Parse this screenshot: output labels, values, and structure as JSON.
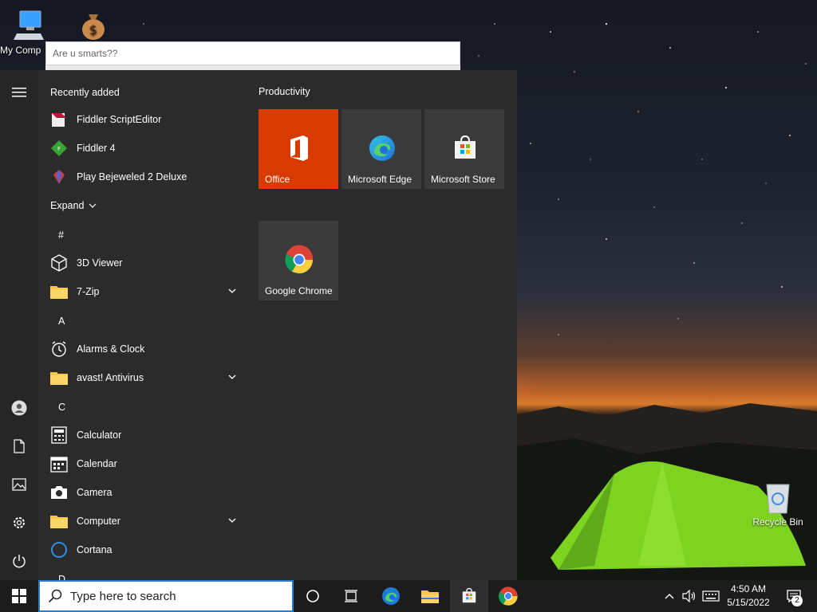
{
  "desktop": {
    "icons": [
      {
        "label": "My Comp"
      },
      {
        "label": ""
      },
      {
        "label": "Recycle Bin"
      }
    ]
  },
  "flyout": {
    "placeholder": "Are u smarts??"
  },
  "start_menu": {
    "recently_added_label": "Recently added",
    "recent": [
      {
        "label": "Fiddler ScriptEditor"
      },
      {
        "label": "Fiddler 4"
      },
      {
        "label": "Play Bejeweled 2 Deluxe"
      }
    ],
    "expand_label": "Expand",
    "groups": [
      {
        "letter": "#"
      },
      {
        "letter": "A"
      },
      {
        "letter": "C"
      },
      {
        "letter": "D"
      }
    ],
    "apps": [
      {
        "label": "3D Viewer"
      },
      {
        "label": "7-Zip"
      },
      {
        "label": "Alarms & Clock"
      },
      {
        "label": "avast! Antivirus"
      },
      {
        "label": "Calculator"
      },
      {
        "label": "Calendar"
      },
      {
        "label": "Camera"
      },
      {
        "label": "Computer"
      },
      {
        "label": "Cortana"
      }
    ],
    "tiles_group_label": "Productivity",
    "tiles": [
      {
        "label": "Office",
        "color": "#d83b01"
      },
      {
        "label": "Microsoft Edge",
        "color": "#3a3a3a"
      },
      {
        "label": "Microsoft Store",
        "color": "#3a3a3a"
      },
      {
        "label": "Google Chrome",
        "color": "#3a3a3a"
      }
    ]
  },
  "taskbar": {
    "search_placeholder": "Type here to search",
    "time": "4:50 AM",
    "date": "5/15/2022",
    "notification_count": "2"
  },
  "colors": {
    "accent": "#2a7fd4",
    "office": "#d83b01",
    "start_bg": "#2b2b2b",
    "taskbar_bg": "#1c1c1c"
  }
}
